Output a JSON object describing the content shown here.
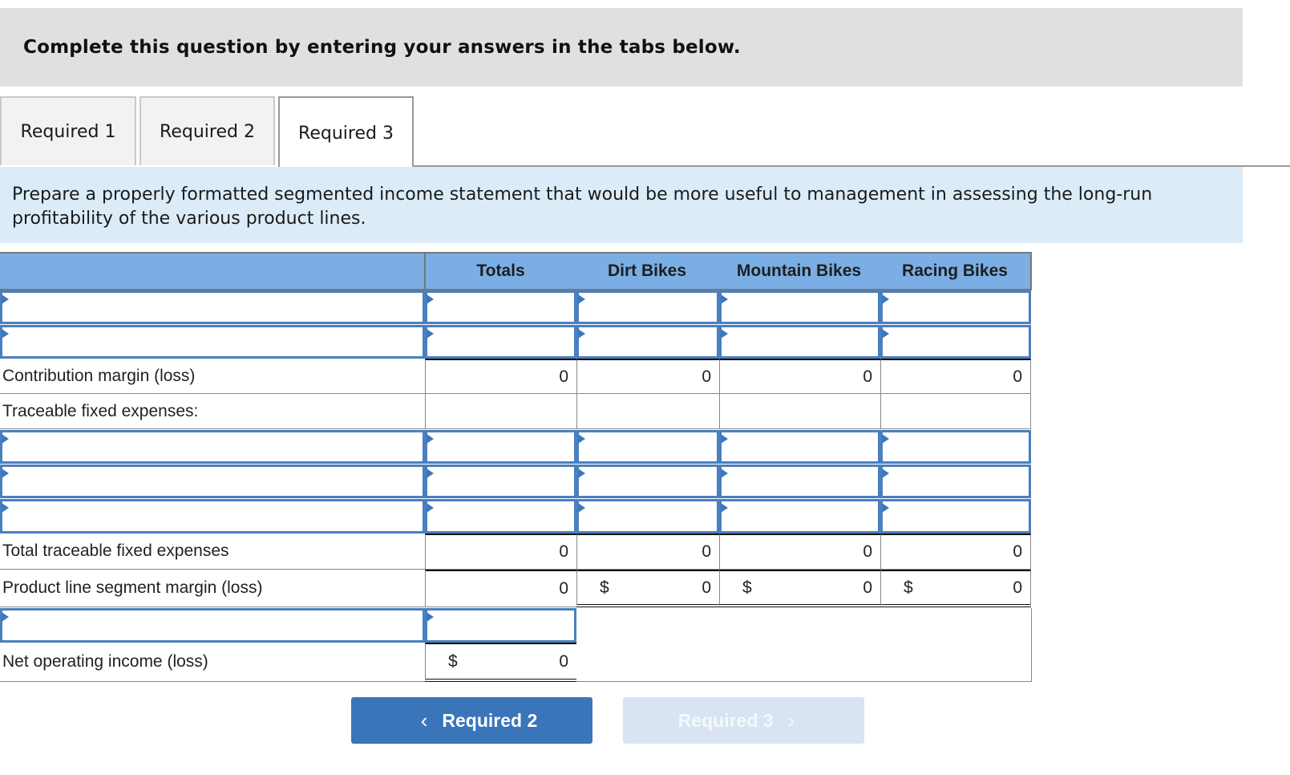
{
  "banner": {
    "text": "Complete this question by entering your answers in the tabs below."
  },
  "tabs": [
    {
      "label": "Required 1",
      "active": false
    },
    {
      "label": "Required 2",
      "active": false
    },
    {
      "label": "Required 3",
      "active": true
    }
  ],
  "instructions": "Prepare a properly formatted segmented income statement that would be more useful to management in assessing the long-run profitability of the various product lines.",
  "table": {
    "columns": [
      "Totals",
      "Dirt Bikes",
      "Mountain Bikes",
      "Racing Bikes"
    ],
    "rows": {
      "contribution_margin": {
        "label": "Contribution margin (loss)",
        "values": [
          "0",
          "0",
          "0",
          "0"
        ]
      },
      "traceable_fixed": {
        "label": "Traceable fixed expenses:"
      },
      "total_traceable": {
        "label": "Total traceable fixed expenses",
        "values": [
          "0",
          "0",
          "0",
          "0"
        ]
      },
      "segment_margin": {
        "label": "Product line segment margin (loss)",
        "values": [
          "0",
          "0",
          "0",
          "0"
        ],
        "currency": "$"
      },
      "net_operating_income": {
        "label": "Net operating income (loss)",
        "value": "0",
        "currency": "$"
      }
    }
  },
  "nav": {
    "prev_label": "Required 2",
    "prev_icon": "chevron-left-icon",
    "next_label": "Required 3",
    "next_icon": "chevron-right-icon",
    "next_disabled": true
  }
}
